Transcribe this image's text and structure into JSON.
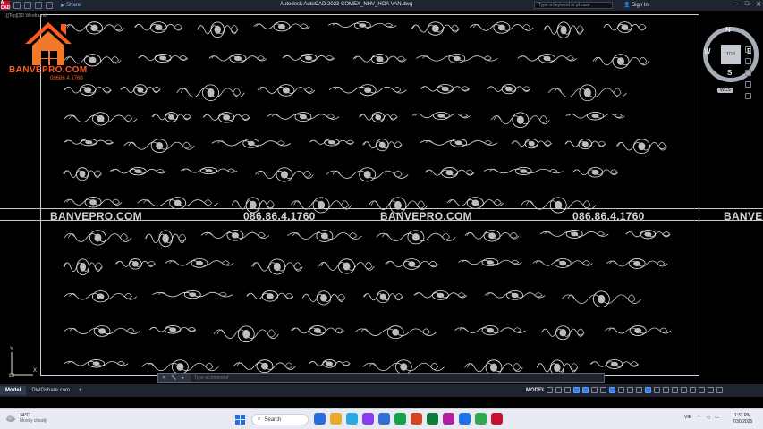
{
  "window": {
    "app_badge": "A CAD",
    "share_label": "Share",
    "title": "Autodesk AutoCAD 2023    COMEX_NHV_HOA VAN.dwg",
    "search_placeholder": "Type a keyword or phrase",
    "signin_label": "Sign In",
    "controls": {
      "minimize": "–",
      "maximize": "□",
      "close": "✕"
    }
  },
  "viewport": {
    "view_controls": "[-][Top][2D Wireframe]",
    "viewcube": {
      "top_face": "TOP",
      "north": "N",
      "south": "S",
      "east": "E",
      "west": "W",
      "wcs": "WCS"
    },
    "ucs": {
      "x": "X",
      "y": "Y"
    }
  },
  "watermark": {
    "items": [
      "BANVEPRO.COM",
      "086.86.4.1760",
      "BANVEPRO.COM",
      "086.86.4.1760",
      "BANVE"
    ]
  },
  "logo": {
    "name": "BANVEPRO.COM",
    "phone": "08686.4.1760",
    "color": "#ff5a1f"
  },
  "command": {
    "placeholder": "Type a command",
    "icons": [
      "✕",
      "🔧",
      "▸"
    ]
  },
  "layout_tabs": {
    "tabs": [
      {
        "label": "Model",
        "active": true
      },
      {
        "label": "DWGshare.com",
        "active": false
      }
    ],
    "add": "+"
  },
  "status_bar": {
    "model_label": "MODEL"
  },
  "taskbar": {
    "weather_temp": "34°C",
    "weather_desc": "Mostly cloudy",
    "search_label": "Search",
    "language": "VIE",
    "time": "1:37 PM",
    "date": "7/30/2025",
    "app_colors": [
      "#2b6be0",
      "#e8a92c",
      "#2aa8e0",
      "#8a3df0",
      "#2f6fd6",
      "#15a34a",
      "#d4471c",
      "#0f7b3a",
      "#b41e9f",
      "#1a73e8",
      "#2fa84f",
      "#c8102e"
    ]
  }
}
